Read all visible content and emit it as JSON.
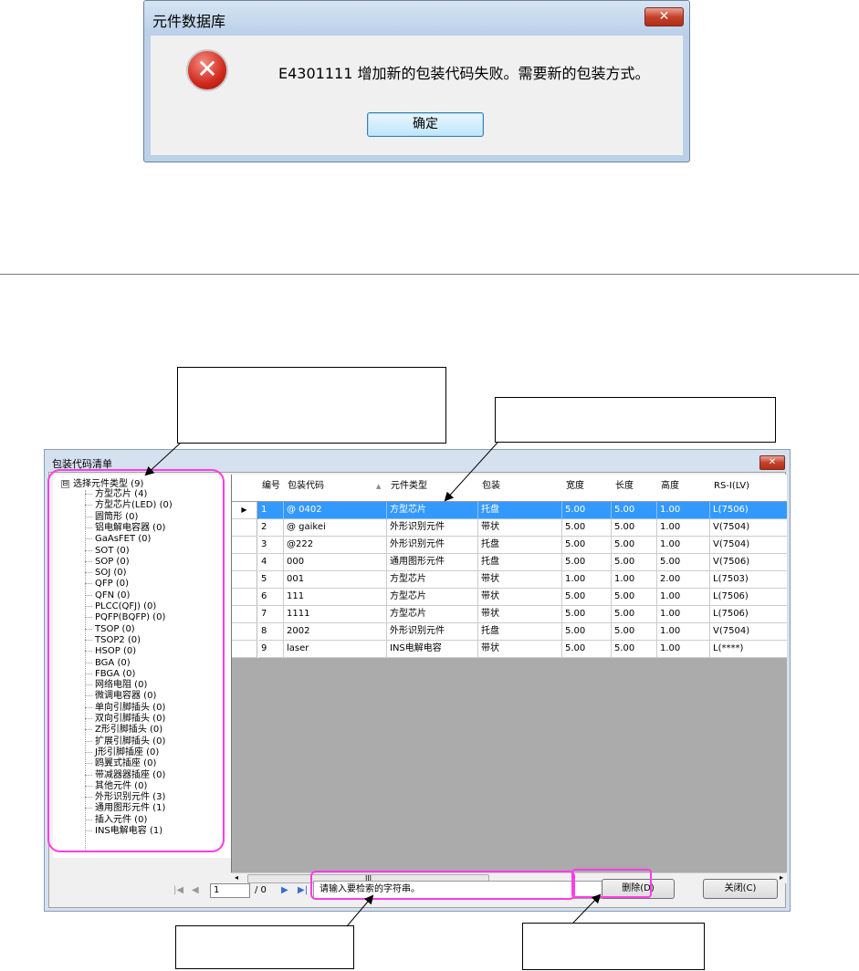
{
  "msgbox": {
    "title": "元件数据库",
    "close_glyph": "✕",
    "error_glyph": "✕",
    "message": "E4301111 增加新的包装代码失败。需要新的包装方式。",
    "ok_label": "确定"
  },
  "window": {
    "title": "包装代码清单",
    "close_glyph": "✕"
  },
  "tree": {
    "expander": "⊟",
    "root": "选择元件类型 (9)",
    "items": [
      "方型芯片 (4)",
      "方型芯片(LED) (0)",
      "圆筒形 (0)",
      "铝电解电容器 (0)",
      "GaAsFET (0)",
      "SOT (0)",
      "SOP (0)",
      "SOJ (0)",
      "QFP (0)",
      "QFN (0)",
      "PLCC(QFJ) (0)",
      "PQFP(BQFP) (0)",
      "TSOP (0)",
      "TSOP2 (0)",
      "HSOP (0)",
      "BGA (0)",
      "FBGA (0)",
      "网络电阻 (0)",
      "微调电容器 (0)",
      "单向引脚插头 (0)",
      "双向引脚插头 (0)",
      "Z形引脚插头 (0)",
      "扩展引脚插头 (0)",
      "J形引脚插座 (0)",
      "鸥翼式插座 (0)",
      "带减器器插座 (0)",
      "其他元件 (0)",
      "外形识别元件 (3)",
      "通用图形元件 (1)",
      "插入元件 (0)",
      "INS电解电容 (1)"
    ]
  },
  "grid": {
    "columns": [
      "编号",
      "包装代码",
      "元件类型",
      "包装",
      "宽度",
      "长度",
      "高度",
      "RS-I(LV)"
    ],
    "sort_glyph": "▲",
    "row_marker": "▶",
    "rows": [
      [
        "1",
        "@ 0402",
        "方型芯片",
        "托盘",
        "5.00",
        "5.00",
        "1.00",
        "L(7506)"
      ],
      [
        "2",
        "@ gaikei",
        "外形识别元件",
        "带状",
        "5.00",
        "5.00",
        "1.00",
        "V(7504)"
      ],
      [
        "3",
        "@222",
        "外形识别元件",
        "托盘",
        "5.00",
        "5.00",
        "1.00",
        "V(7504)"
      ],
      [
        "4",
        "000",
        "通用图形元件",
        "托盘",
        "5.00",
        "5.00",
        "5.00",
        "V(7506)"
      ],
      [
        "5",
        "001",
        "方型芯片",
        "带状",
        "1.00",
        "1.00",
        "2.00",
        "L(7503)"
      ],
      [
        "6",
        "111",
        "方型芯片",
        "带状",
        "5.00",
        "5.00",
        "1.00",
        "L(7506)"
      ],
      [
        "7",
        "1111",
        "方型芯片",
        "带状",
        "5.00",
        "5.00",
        "1.00",
        "L(7506)"
      ],
      [
        "8",
        "2002",
        "外形识别元件",
        "托盘",
        "5.00",
        "5.00",
        "1.00",
        "V(7504)"
      ],
      [
        "9",
        "laser",
        "INS电解电容",
        "带状",
        "5.00",
        "5.00",
        "1.00",
        "L(****)"
      ]
    ]
  },
  "scroll": {
    "thumb": "III",
    "left": "◂",
    "right": "▸"
  },
  "nav": {
    "first": "|◀",
    "prev": "◀",
    "page": "1",
    "total": "/ 0",
    "next": "▶",
    "last": "▶|"
  },
  "search": {
    "placeholder": "请输入要检索的字符串。"
  },
  "buttons": {
    "delete": "删除(D)",
    "close": "关闭(C)"
  },
  "colors": {
    "highlight": "#ff3ce6",
    "selection": "#3399ff"
  }
}
